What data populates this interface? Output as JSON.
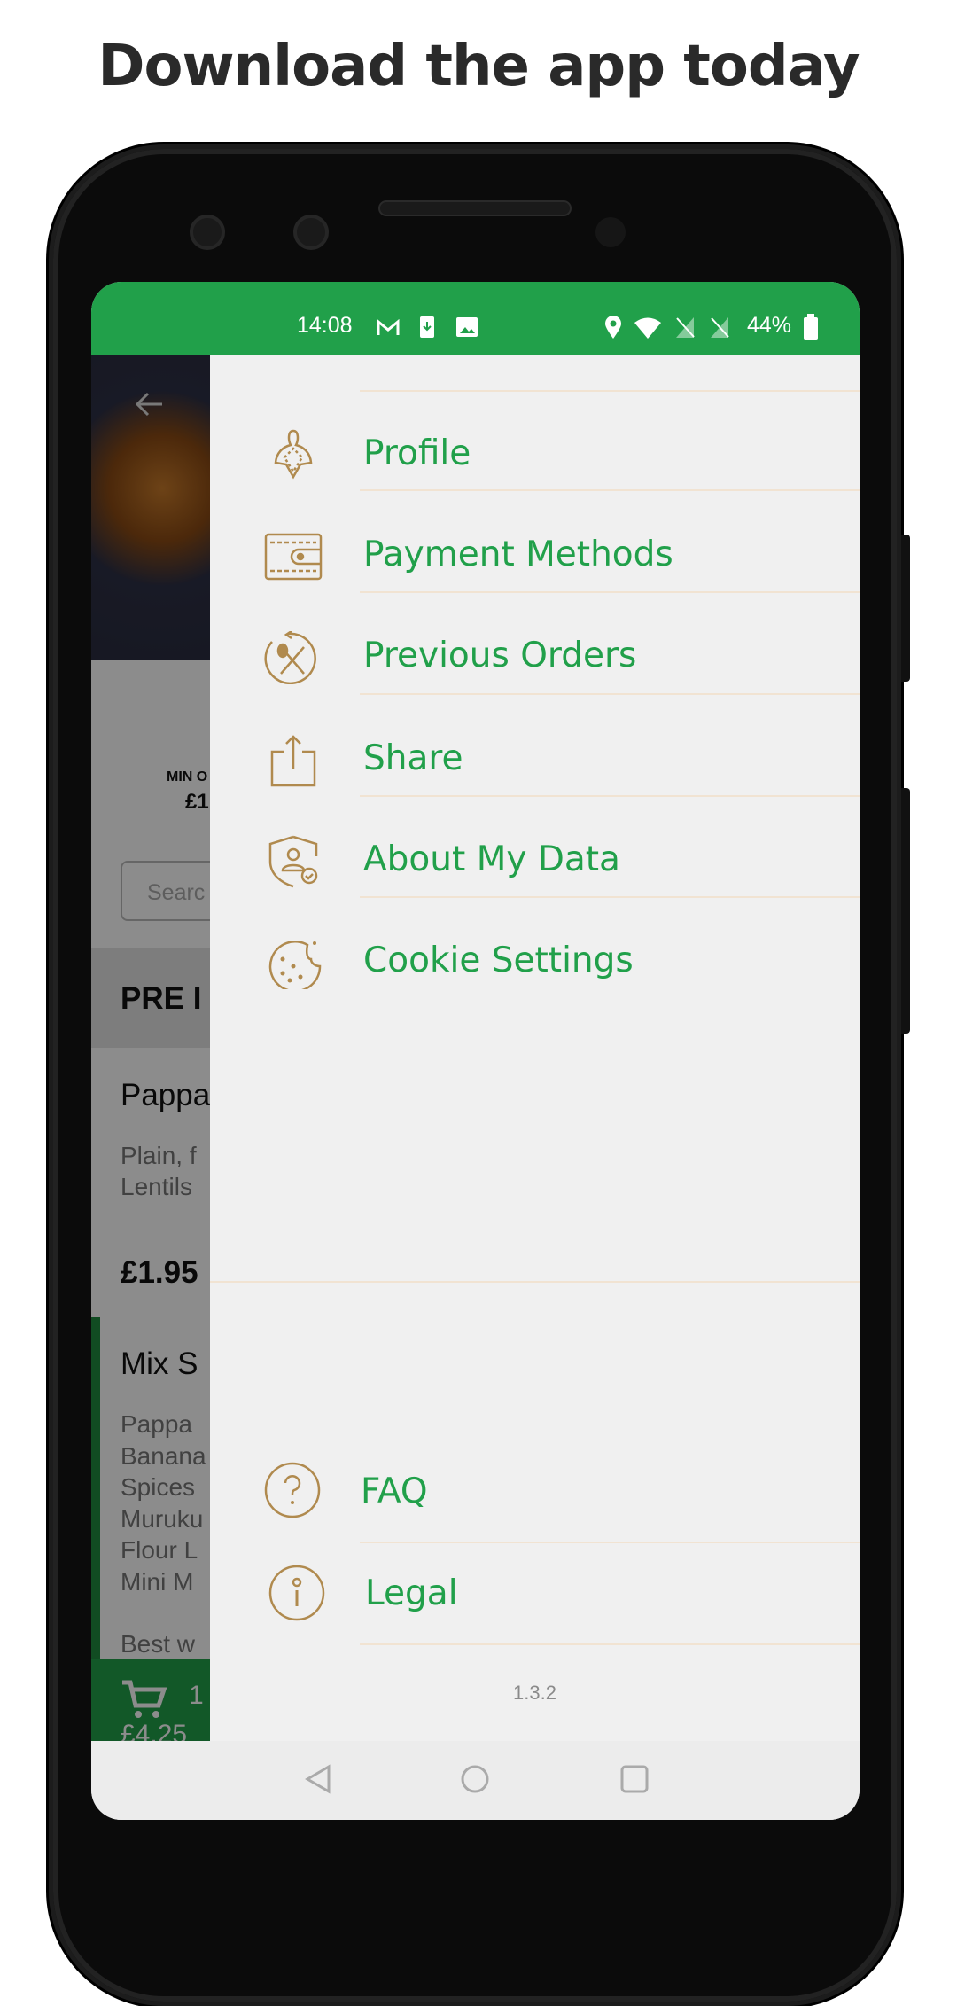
{
  "headline": "Download the app today",
  "status_bar": {
    "time": "14:08",
    "battery": "44%",
    "icons": [
      "gmail-icon",
      "download-icon",
      "image-icon",
      "location-icon",
      "wifi-icon",
      "no-signal-icon",
      "no-signal-icon",
      "battery-icon"
    ]
  },
  "background_app": {
    "min_order_label": "MIN O",
    "min_order_value": "£1",
    "search_placeholder": "Searc",
    "section_title": "PRE I",
    "items": [
      {
        "name": "Pappa",
        "desc": [
          "Plain, f",
          "Lentils"
        ],
        "price": "£1.95"
      },
      {
        "name": "Mix S",
        "desc": [
          "Pappa",
          "Banana",
          "Spices",
          "Muruku",
          "Flour L",
          "Mini M",
          "",
          "Best w"
        ]
      }
    ],
    "cart": {
      "count": "1",
      "total": "£4.25"
    }
  },
  "drawer": {
    "items": [
      {
        "label": "Profile",
        "icon": "profile-icon"
      },
      {
        "label": "Payment Methods",
        "icon": "wallet-icon"
      },
      {
        "label": "Previous Orders",
        "icon": "previous-orders-icon"
      },
      {
        "label": "Share",
        "icon": "share-icon"
      },
      {
        "label": "About My Data",
        "icon": "data-shield-icon"
      },
      {
        "label": "Cookie Settings",
        "icon": "cookie-icon"
      }
    ],
    "bottom_items": [
      {
        "label": "FAQ",
        "icon": "question-icon"
      },
      {
        "label": "Legal",
        "icon": "info-icon"
      }
    ],
    "version": "1.3.2"
  },
  "colors": {
    "brand_green": "#21a04a",
    "icon_brown": "#b08a4e",
    "divider": "#f1e3d2"
  }
}
